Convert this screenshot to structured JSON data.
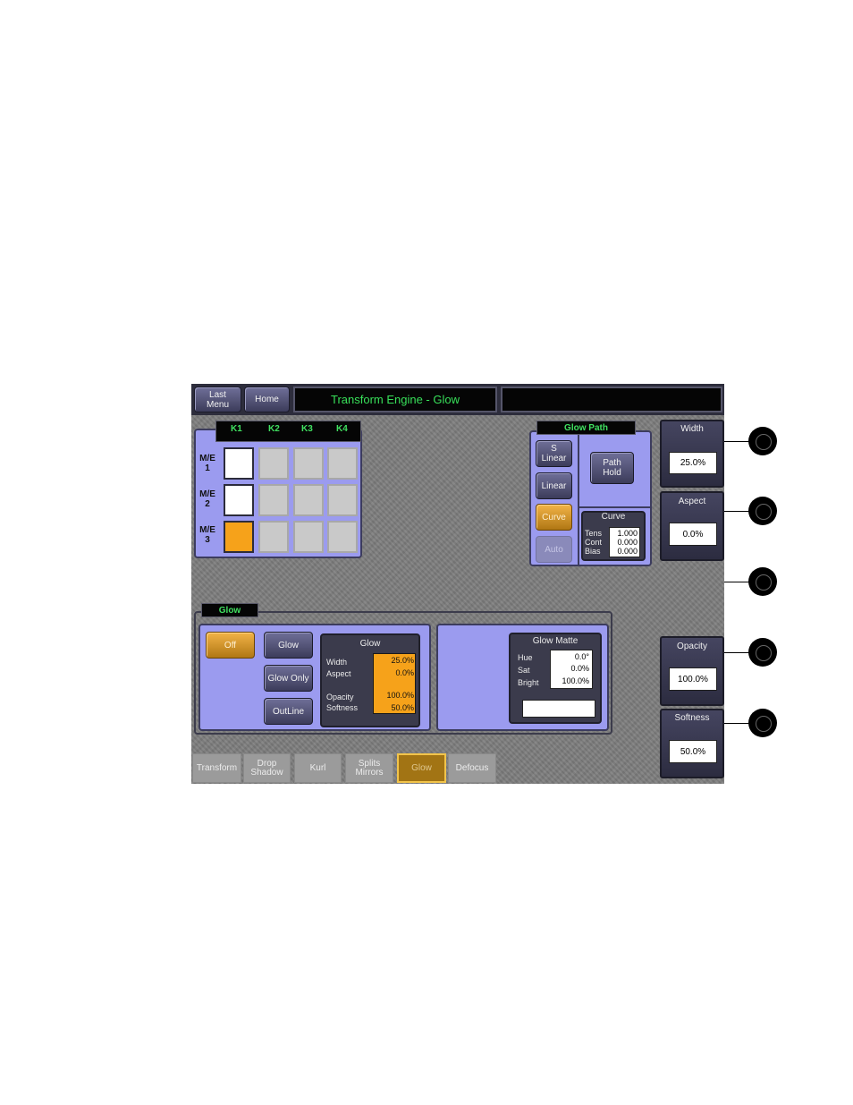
{
  "header": {
    "last_menu": "Last\nMenu",
    "home": "Home",
    "title": "Transform Engine - Glow",
    "status": ""
  },
  "keyer_grid": {
    "columns": [
      "K1",
      "K2",
      "K3",
      "K4"
    ],
    "rows": [
      "M/E\n1",
      "M/E\n2",
      "M/E\n3"
    ]
  },
  "glow_path": {
    "title": "Glow Path",
    "s_linear": "S\nLinear",
    "linear": "Linear",
    "curve": "Curve",
    "auto": "Auto",
    "path_hold": "Path\nHold",
    "curve_box": {
      "title": "Curve",
      "tens_label": "Tens",
      "tens_value": "1.000",
      "cont_label": "Cont",
      "cont_value": "0.000",
      "bias_label": "Bias",
      "bias_value": "0.000"
    }
  },
  "knobs": [
    {
      "label": "Width",
      "value": "25.0%"
    },
    {
      "label": "Aspect",
      "value": "0.0%"
    },
    {
      "label": "Opacity",
      "value": "100.0%"
    },
    {
      "label": "Softness",
      "value": "50.0%"
    }
  ],
  "glow_section": {
    "title": "Glow",
    "off": "Off",
    "glow": "Glow",
    "glow_only": "Glow Only",
    "outline": "OutLine",
    "summary": {
      "title": "Glow",
      "width_label": "Width",
      "width_value": "25.0%",
      "aspect_label": "Aspect",
      "aspect_value": "0.0%",
      "opacity_label": "Opacity",
      "opacity_value": "100.0%",
      "softness_label": "Softness",
      "softness_value": "50.0%"
    },
    "matte": {
      "title": "Glow Matte",
      "hue_label": "Hue",
      "hue_value": "0.0°",
      "sat_label": "Sat",
      "sat_value": "0.0%",
      "bright_label": "Bright",
      "bright_value": "100.0%",
      "swatch_color": "#ffffff"
    }
  },
  "tabs": [
    {
      "label": "Transform"
    },
    {
      "label": "Drop\nShadow"
    },
    {
      "label": "Kurl"
    },
    {
      "label": "Splits\nMirrors"
    },
    {
      "label": "Glow"
    },
    {
      "label": "Defocus"
    }
  ],
  "colors": {
    "accent_orange": "#f6a21a",
    "panel_lavender": "#9b9bef",
    "title_green": "#38e05a"
  }
}
